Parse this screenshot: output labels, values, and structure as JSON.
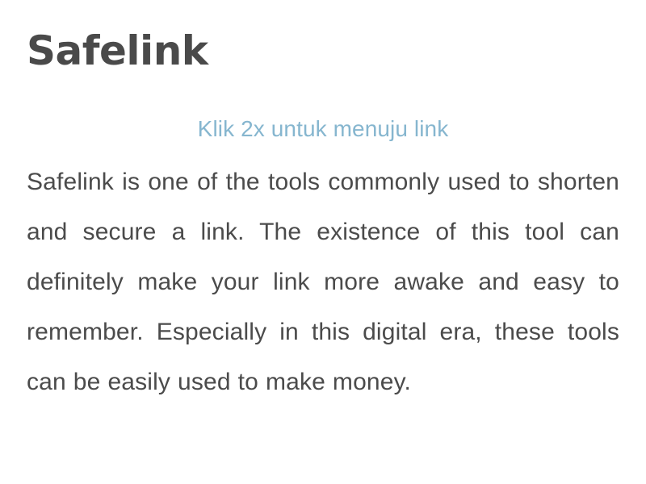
{
  "page": {
    "background_color": "#ffffff"
  },
  "header": {
    "site_title": "Safelink",
    "title_color": "#4a4a4a"
  },
  "notice": {
    "subtitle": "Klik 2x untuk menuju link",
    "subtitle_color": "#86b6cf"
  },
  "article": {
    "body": "Safelink is one of the tools commonly used to shorten and secure a link. The existence of this tool can definitely make your link more awake and easy to remember. Especially in this digital era, these tools can be easily used to make money.",
    "body_color": "#4b4b4b",
    "lines": [
      "Safelink is one of the tools commonly used",
      "to shorten and secure a link. The existence",
      "of this tool can definitely make your link",
      "more awake and easy to remember.",
      "Especially in this digital era, these tools can",
      "be easily used to make money."
    ]
  }
}
